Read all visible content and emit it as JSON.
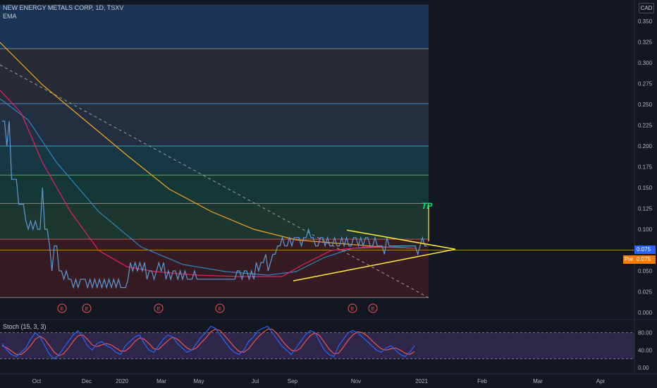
{
  "header": {
    "symbol_line": "NEW ENERGY METALS CORP, 1D, TSXV",
    "indicator_label": "EMA",
    "currency": "CAD"
  },
  "stoch_panel": {
    "label": "Stoch (15, 3, 3)",
    "levels": [
      80,
      40,
      0
    ],
    "level_labels": [
      "80.00",
      "40.00",
      "0.00"
    ],
    "k": [
      55,
      40,
      30,
      25,
      35,
      45,
      65,
      80,
      70,
      50,
      30,
      20,
      30,
      45,
      60,
      75,
      85,
      70,
      50,
      40,
      55,
      60,
      50,
      45,
      35,
      30,
      50,
      60,
      70,
      75,
      55,
      40,
      35,
      50,
      65,
      75,
      70,
      55,
      45,
      35,
      40,
      55,
      70,
      80,
      95,
      90,
      75,
      60,
      45,
      35,
      30,
      40,
      60,
      70,
      85,
      90,
      95,
      80,
      65,
      50,
      40,
      30,
      45,
      60,
      75,
      85,
      80,
      60,
      40,
      30,
      25,
      50,
      65,
      80,
      85,
      80,
      70,
      60,
      50,
      40,
      35,
      45,
      50,
      40,
      30,
      25,
      35,
      50
    ],
    "d": [
      50,
      45,
      38,
      30,
      30,
      38,
      50,
      65,
      72,
      65,
      50,
      35,
      27,
      32,
      45,
      60,
      73,
      75,
      65,
      52,
      48,
      52,
      55,
      52,
      45,
      38,
      38,
      47,
      60,
      68,
      65,
      55,
      43,
      42,
      52,
      62,
      70,
      65,
      55,
      45,
      40,
      45,
      57,
      68,
      82,
      88,
      85,
      73,
      60,
      47,
      37,
      35,
      43,
      57,
      70,
      80,
      88,
      88,
      78,
      63,
      50,
      40,
      38,
      45,
      60,
      73,
      80,
      73,
      58,
      42,
      32,
      33,
      47,
      63,
      75,
      82,
      80,
      73,
      62,
      52,
      43,
      40,
      43,
      45,
      40,
      33,
      30,
      37
    ]
  },
  "price_axis": {
    "labels": [
      "0.350",
      "0.325",
      "0.300",
      "0.275",
      "0.250",
      "0.225",
      "0.200",
      "0.175",
      "0.150",
      "0.125",
      "0.100",
      "0.075",
      "0.050",
      "0.025",
      "0.000"
    ],
    "last_price": "0.075",
    "pre_label": "Pre",
    "pre_price": "0.075"
  },
  "time_axis": {
    "labels": [
      "Oct",
      "Dec",
      "2020",
      "Mar",
      "May",
      "Jul",
      "Sep",
      "Nov",
      "2021",
      "Feb",
      "Mar",
      "Apr"
    ]
  },
  "annotations": {
    "target_text": "TP",
    "earnings_marker": "E"
  },
  "colors": {
    "background": "#131722",
    "price_line": "#5b9bd5",
    "ema_fast": "#e91e63",
    "ema_mid": "#2e86c1",
    "ema_slow": "#f5a623",
    "triangle": "#ffeb3b",
    "target": "#00e676",
    "stoch_k": "#2962ff",
    "stoch_d": "#ef5350",
    "stoch_band": "#7e57c2"
  },
  "chart_data": {
    "type": "line",
    "title": "NEW ENERGY METALS CORP, 1D, TSXV",
    "ylim": [
      0,
      0.37
    ],
    "series": [
      {
        "name": "",
        "x_days": [
          0,
          3,
          6,
          9,
          12,
          15,
          18,
          21,
          24,
          27,
          30,
          33,
          36,
          39,
          42,
          45,
          48,
          51,
          54,
          57,
          60,
          63,
          66,
          69,
          72,
          75,
          78,
          81,
          84,
          87,
          90,
          93,
          96,
          99,
          102,
          105,
          108,
          111,
          114,
          117,
          120,
          123,
          126,
          129,
          132,
          135,
          138,
          141,
          144,
          147,
          150,
          153,
          156,
          159,
          162,
          165,
          168,
          171,
          174,
          177,
          180,
          183,
          186,
          189,
          192,
          195,
          198,
          201,
          204,
          207,
          210,
          213,
          216,
          219,
          222,
          225,
          228,
          231,
          234,
          237,
          240,
          243,
          246,
          249,
          252,
          255,
          258,
          261,
          264,
          267,
          270,
          273,
          276,
          279,
          282,
          285,
          288,
          291,
          294,
          297,
          300,
          303,
          306,
          309,
          312,
          315,
          318,
          321,
          324,
          327,
          330,
          333,
          336,
          339,
          342,
          345,
          348,
          351,
          354,
          357,
          360,
          363,
          366,
          369,
          372,
          375,
          378,
          381,
          384,
          387,
          390,
          393,
          396,
          399,
          402,
          405,
          408,
          411,
          414,
          417,
          420,
          423,
          426,
          429,
          432,
          435,
          438,
          441,
          444,
          447,
          450,
          453,
          456,
          459,
          462,
          465,
          468,
          471,
          474,
          477,
          480,
          483,
          486,
          489,
          492,
          495,
          498,
          501,
          504,
          507,
          510,
          513,
          516,
          519,
          522,
          525,
          528,
          531,
          534,
          537
        ],
        "values": [
          0.23,
          0.23,
          0.2,
          0.23,
          0.16,
          0.16,
          0.16,
          0.13,
          0.13,
          0.13,
          0.11,
          0.1,
          0.11,
          0.1,
          0.11,
          0.1,
          0.1,
          0.15,
          0.1,
          0.1,
          0.08,
          0.05,
          0.08,
          0.08,
          0.05,
          0.05,
          0.04,
          0.05,
          0.04,
          0.04,
          0.03,
          0.04,
          0.03,
          0.04,
          0.04,
          0.04,
          0.03,
          0.04,
          0.03,
          0.04,
          0.03,
          0.04,
          0.03,
          0.04,
          0.03,
          0.04,
          0.03,
          0.04,
          0.03,
          0.04,
          0.03,
          0.03,
          0.03,
          0.04,
          0.06,
          0.05,
          0.06,
          0.05,
          0.06,
          0.05,
          0.06,
          0.04,
          0.05,
          0.05,
          0.04,
          0.05,
          0.06,
          0.05,
          0.06,
          0.04,
          0.05,
          0.04,
          0.05,
          0.05,
          0.04,
          0.05,
          0.04,
          0.05,
          0.04,
          0.04,
          0.04,
          0.05,
          0.04,
          0.04,
          0.04,
          0.04,
          0.04,
          0.04,
          0.04,
          0.04,
          0.04,
          0.04,
          0.04,
          0.04,
          0.04,
          0.04,
          0.04,
          0.04,
          0.04,
          0.05,
          0.05,
          0.04,
          0.05,
          0.05,
          0.04,
          0.05,
          0.04,
          0.06,
          0.05,
          0.06,
          0.06,
          0.07,
          0.05,
          0.06,
          0.07,
          0.07,
          0.08,
          0.08,
          0.09,
          0.08,
          0.08,
          0.09,
          0.08,
          0.09,
          0.09,
          0.09,
          0.08,
          0.09,
          0.09,
          0.1,
          0.09,
          0.09,
          0.08,
          0.08,
          0.09,
          0.09,
          0.08,
          0.09,
          0.08,
          0.08,
          0.09,
          0.08,
          0.08,
          0.09,
          0.08,
          0.09,
          0.08,
          0.08,
          0.09,
          0.09,
          0.08,
          0.09,
          0.08,
          0.09,
          0.09,
          0.08,
          0.08,
          0.09,
          0.08,
          0.08,
          0.08,
          0.07,
          0.09,
          0.08,
          0.08,
          0.08,
          0.08,
          0.08,
          0.08,
          0.08,
          0.08,
          0.08,
          0.08,
          0.08,
          0.08,
          0.07,
          0.08,
          0.09,
          0.08,
          0.08,
          0.08,
          0.08
        ]
      }
    ],
    "fib_levels": [
      0.317,
      0.251,
      0.2,
      0.165,
      0.131,
      0.088,
      0.075,
      0.018
    ],
    "triangle": {
      "apex_price": 0.076,
      "upper_start_price": 0.099,
      "lower_start_price": 0.038
    },
    "target_price": 0.131
  }
}
